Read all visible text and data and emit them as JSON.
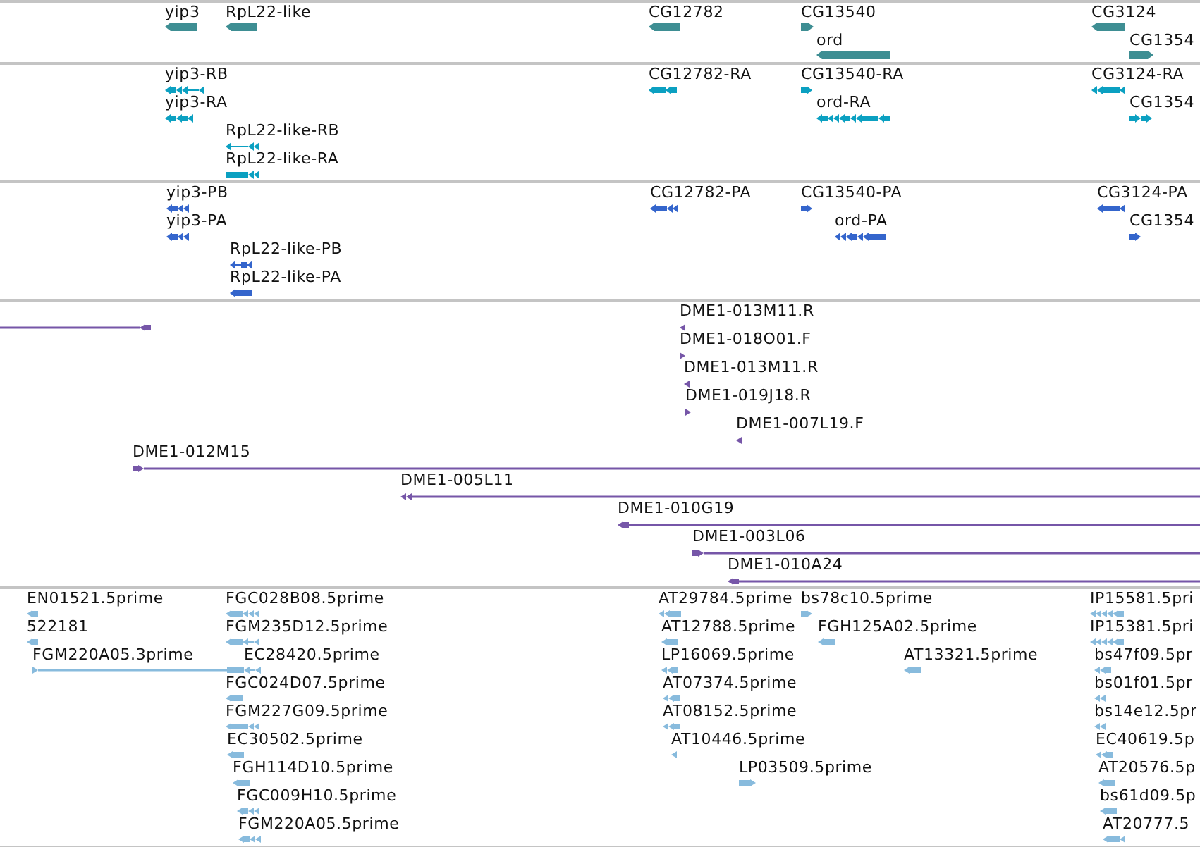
{
  "tracks": [
    {
      "kind": "gene",
      "color": "#3e8e93",
      "features": [
        {
          "label": "yip3",
          "reverse": true
        },
        {
          "label": "RpL22-like",
          "reverse": true
        },
        {
          "label": "CG12782",
          "reverse": true
        },
        {
          "label": "CG13540",
          "reverse": false
        },
        {
          "label": "ord",
          "reverse": true
        },
        {
          "label": "CG3124",
          "reverse": true
        },
        {
          "label": "CG1354",
          "reverse": false
        }
      ]
    },
    {
      "kind": "transcript",
      "color": "#0ba0c1",
      "features": [
        {
          "label": "yip3-RB",
          "reverse": true
        },
        {
          "label": "yip3-RA",
          "reverse": true
        },
        {
          "label": "RpL22-like-RB",
          "reverse": true
        },
        {
          "label": "RpL22-like-RA",
          "reverse": true
        },
        {
          "label": "CG12782-RA",
          "reverse": true
        },
        {
          "label": "CG13540-RA",
          "reverse": false
        },
        {
          "label": "ord-RA",
          "reverse": true
        },
        {
          "label": "CG3124-RA",
          "reverse": true
        },
        {
          "label": "CG1354",
          "reverse": false
        }
      ]
    },
    {
      "kind": "protein",
      "color": "#3465cc",
      "features": [
        {
          "label": "yip3-PB",
          "reverse": true
        },
        {
          "label": "yip3-PA",
          "reverse": true
        },
        {
          "label": "RpL22-like-PB",
          "reverse": true
        },
        {
          "label": "RpL22-like-PA",
          "reverse": true
        },
        {
          "label": "CG12782-PA",
          "reverse": true
        },
        {
          "label": "CG13540-PA",
          "reverse": false
        },
        {
          "label": "ord-PA",
          "reverse": true
        },
        {
          "label": "CG3124-PA",
          "reverse": true
        },
        {
          "label": "CG1354",
          "reverse": false
        }
      ]
    },
    {
      "kind": "clone",
      "color": "#7656a8",
      "features": [
        {
          "reverse": true
        },
        {
          "label": "DME1-013M11.R",
          "reverse": true
        },
        {
          "label": "DME1-018O01.F",
          "reverse": false
        },
        {
          "label": "DME1-013M11.R",
          "reverse": true
        },
        {
          "label": "DME1-019J18.R",
          "reverse": false
        },
        {
          "label": "DME1-007L19.F",
          "reverse": true
        },
        {
          "label": "DME1-012M15",
          "reverse": false
        },
        {
          "label": "DME1-005L11",
          "reverse": true
        },
        {
          "label": "DME1-010G19",
          "reverse": true
        },
        {
          "label": "DME1-003L06",
          "reverse": false
        },
        {
          "label": "DME1-010A24",
          "reverse": true
        }
      ]
    },
    {
      "kind": "est",
      "color": "#88bbdd",
      "features": [
        {
          "label": "EN01521.5prime",
          "reverse": true
        },
        {
          "label": "522181",
          "reverse": true
        },
        {
          "label": "FGM220A05.3prime",
          "reverse": false
        },
        {
          "label": "FGC028B08.5prime",
          "reverse": true
        },
        {
          "label": "FGM235D12.5prime",
          "reverse": true
        },
        {
          "label": "EC28420.5prime",
          "reverse": true
        },
        {
          "label": "FGC024D07.5prime",
          "reverse": true
        },
        {
          "label": "FGM227G09.5prime",
          "reverse": true
        },
        {
          "label": "EC30502.5prime",
          "reverse": true
        },
        {
          "label": "FGH114D10.5prime",
          "reverse": true
        },
        {
          "label": "FGC009H10.5prime",
          "reverse": true
        },
        {
          "label": "FGM220A05.5prime",
          "reverse": true
        },
        {
          "label": "AT29784.5prime",
          "reverse": true
        },
        {
          "label": "bs78c10.5prime",
          "reverse": false
        },
        {
          "label": "AT12788.5prime",
          "reverse": true
        },
        {
          "label": "FGH125A02.5prime",
          "reverse": true
        },
        {
          "label": "LP16069.5prime",
          "reverse": true
        },
        {
          "label": "AT13321.5prime",
          "reverse": true
        },
        {
          "label": "AT07374.5prime",
          "reverse": true
        },
        {
          "label": "AT08152.5prime",
          "reverse": true
        },
        {
          "label": "AT10446.5prime",
          "reverse": true
        },
        {
          "label": "LP03509.5prime",
          "reverse": false
        },
        {
          "label": "IP15581.5pri",
          "reverse": true
        },
        {
          "label": "IP15381.5pri",
          "reverse": true
        },
        {
          "label": "bs47f09.5pr",
          "reverse": true
        },
        {
          "label": "bs01f01.5pr",
          "reverse": true
        },
        {
          "label": "bs14e12.5pr",
          "reverse": true
        },
        {
          "label": "EC40619.5p",
          "reverse": true
        },
        {
          "label": "AT20576.5p",
          "reverse": true
        },
        {
          "label": "bs61d09.5p",
          "reverse": true
        },
        {
          "label": "AT20777.5",
          "reverse": true
        }
      ]
    }
  ]
}
